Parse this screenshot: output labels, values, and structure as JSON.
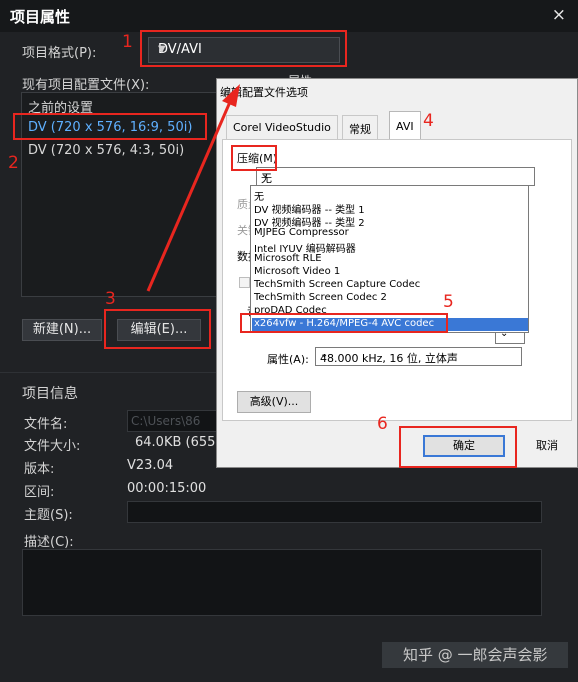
{
  "window": {
    "title": "项目属性",
    "close": "×"
  },
  "main": {
    "format_label": "项目格式(P):",
    "format_value": "DV/AVI",
    "profiles_label": "现有项目配置文件(X):",
    "profiles_right_partial": "属性",
    "profiles": [
      {
        "label": "之前的设置",
        "selected": false
      },
      {
        "label": "DV (720 x 576, 16:9, 50i)",
        "selected": true
      },
      {
        "label": "DV (720 x 576, 4:3, 50i)",
        "selected": false
      }
    ],
    "new_button": "新建(N)...",
    "edit_button": "编辑(E)...",
    "info_heading": "项目信息",
    "info": {
      "filename_label": "文件名:",
      "filename_value": "C:\\Users\\86",
      "filesize_label": "文件大小:",
      "filesize_value": "64.0KB (655",
      "version_label": "版本:",
      "version_value": "V23.04",
      "range_label": "区间:",
      "range_value": "00:00:15:00",
      "subject_label": "主题(S):",
      "desc_label": "描述(C):"
    },
    "watermark": "知乎 @ 一郎会声会影"
  },
  "overlay": {
    "title": "编辑配置文件选项",
    "tabs": [
      "Corel VideoStudio",
      "常规",
      "AVI"
    ],
    "active_tab": "AVI",
    "compression_label": "压缩(M)",
    "compression_value": "无",
    "hidden_labels": [
      "质量",
      "关键",
      "数据",
      "音"
    ],
    "codecs": [
      "无",
      "DV 视频编码器 -- 类型 1",
      "DV 视频编码器 -- 类型 2",
      "MJPEG Compressor",
      "Intel IYUV 编码解码器",
      "Microsoft RLE",
      "Microsoft Video 1",
      "TechSmith Screen Capture Codec",
      "TechSmith Screen Codec 2",
      "proDAD Codec",
      "x264vfw - H.264/MPEG-4 AVC codec"
    ],
    "highlighted_codec_index": 10,
    "attributes_label": "属性(A):",
    "attributes_value": "48.000 kHz, 16 位, 立体声",
    "advanced_button": "高级(V)...",
    "ok_button": "确定",
    "cancel_button": "取消"
  },
  "annotations": [
    "1",
    "2",
    "3",
    "4",
    "5",
    "6"
  ],
  "colors": {
    "annotation": "#e8261f",
    "selected_text": "#5fb0ff",
    "highlight": "#3a78d6"
  }
}
